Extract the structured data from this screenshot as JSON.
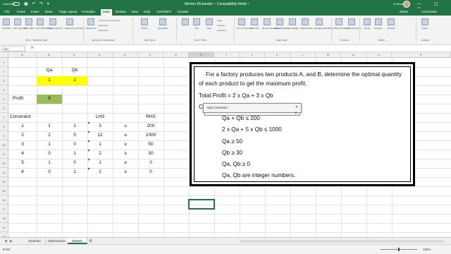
{
  "window": {
    "autosave": "AutoSave",
    "quick_access": "▣ ↶ ↷ ▾",
    "doc_title": "Minimo Richardse ~ Compatibility Mode ~",
    "user": "Al Richards",
    "window_controls": "— ▢ ✕"
  },
  "tabs": [
    {
      "label": "File"
    },
    {
      "label": "Home"
    },
    {
      "label": "Insert"
    },
    {
      "label": "Draw"
    },
    {
      "label": "Page Layout"
    },
    {
      "label": "Formulas"
    },
    {
      "label": "Data"
    },
    {
      "label": "Review"
    },
    {
      "label": "View"
    },
    {
      "label": "Help"
    },
    {
      "label": "ACROBAT"
    },
    {
      "label": "Kinobar"
    }
  ],
  "active_tab": "Data",
  "share_label": "Share",
  "comments_label": "Comments",
  "ribbon": {
    "buttons": [
      {
        "label": "Get Data"
      },
      {
        "label": "From Text/CSV"
      },
      {
        "label": "From Web"
      },
      {
        "label": "From Table/Range"
      },
      {
        "label": "Recent Sources"
      },
      {
        "label": "Existing Connections"
      },
      {
        "label": "Refresh All"
      },
      {
        "label": "Stocks"
      },
      {
        "label": "Geography"
      },
      {
        "label": "Sort"
      },
      {
        "label": "Filter"
      },
      {
        "label": "Text to Columns"
      },
      {
        "label": "Flash Fill"
      },
      {
        "label": "Remove Duplicates"
      },
      {
        "label": "Data Validation"
      },
      {
        "label": "Consolidate"
      },
      {
        "label": "Relationships"
      },
      {
        "label": "Manage Data Model"
      },
      {
        "label": "What-If Analysis"
      },
      {
        "label": "Forecast Sheet"
      },
      {
        "label": "Group"
      },
      {
        "label": "Ungroup"
      },
      {
        "label": "Subtotal"
      },
      {
        "label": "Solver"
      }
    ],
    "small_items": [
      "Queries & Connections",
      "Properties",
      "Edit Links",
      "Clear",
      "Reapply",
      "Advanced"
    ],
    "groups": [
      {
        "label": "Get & Transform Data"
      },
      {
        "label": "Queries & Connections"
      },
      {
        "label": "Data Types"
      },
      {
        "label": "Sort & Filter"
      },
      {
        "label": "Data Tools"
      },
      {
        "label": "Forecast"
      },
      {
        "label": "Outline"
      },
      {
        "label": "Analyze"
      }
    ]
  },
  "formula_bar": {
    "name_box": "H27",
    "fx": "fx"
  },
  "columns": [
    "A",
    "B",
    "C",
    "D",
    "E",
    "F",
    "G",
    "H",
    "I",
    "J",
    "K",
    "L",
    "M",
    "N",
    "O",
    "P"
  ],
  "rows": [
    "1",
    "2",
    "3",
    "4",
    "5",
    "6",
    "7",
    "8",
    "9",
    "10",
    "11",
    "12",
    "13",
    "14",
    "15",
    "16",
    "17",
    "18",
    "19",
    "20"
  ],
  "sheet": {
    "qa_header": "Qa",
    "qb_header": "Qb",
    "qa_value": "1",
    "qb_value": "2",
    "profit_label": "Profit",
    "profit_value": "8",
    "constraint_header": "Constraint",
    "lhs_header": "LHS",
    "rhs_header": "RHS",
    "constraints": [
      {
        "id": "1",
        "a": "1",
        "b": "1",
        "lhs": "3",
        "op": "≤",
        "rhs": "200"
      },
      {
        "id": "2",
        "a": "2",
        "b": "5",
        "lhs": "12",
        "op": "≤",
        "rhs": "1000"
      },
      {
        "id": "3",
        "a": "1",
        "b": "0",
        "lhs": "1",
        "op": "≥",
        "rhs": "50"
      },
      {
        "id": "4",
        "a": "0",
        "b": "1",
        "lhs": "2",
        "op": "≥",
        "rhs": "30"
      },
      {
        "id": "5",
        "a": "1",
        "b": "0",
        "lhs": "1",
        "op": "≥",
        "rhs": "0"
      },
      {
        "id": "6",
        "a": "0",
        "b": "1",
        "lhs": "2",
        "op": "≥",
        "rhs": "0"
      }
    ]
  },
  "textbox": {
    "line1": "For a factory produces two products A, and B, determine the optimal quantity",
    "line2": "of each product to get the maximum profit.",
    "line3": "Total Profit = 2 x Qa + 3 x Qb",
    "line4": "Co",
    "constraints": [
      "Qa + Qb ≤ 200",
      "2 x Qa + 5 x Qb ≤ 1000",
      "Qa ≥ 50",
      "Qb ≥ 30",
      "Qa, Qb ≥ 0",
      "Qa, Qb are integer numbers."
    ]
  },
  "dialog": {
    "title": "Add Constraint",
    "close": "✕"
  },
  "sheet_tabs": [
    {
      "label": "Students"
    },
    {
      "label": "Optimization"
    },
    {
      "label": "Sheet1"
    }
  ],
  "active_sheet": "Sheet1",
  "status": {
    "mode": "Enter",
    "zoom": "100%"
  }
}
